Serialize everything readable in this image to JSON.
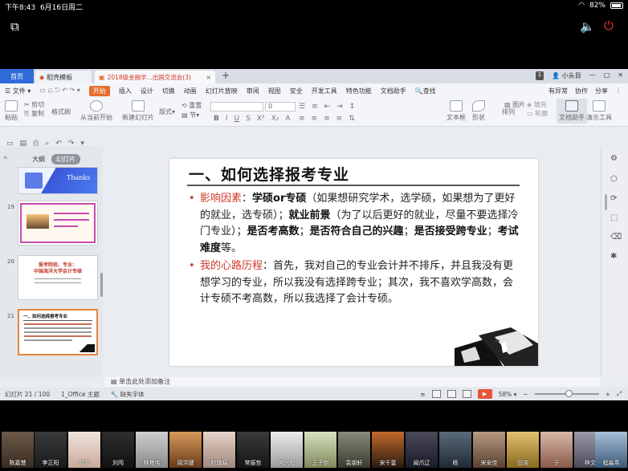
{
  "status_bar": {
    "time": "下午8:43",
    "date": "6月16日周二",
    "wifi": "wifi-icon",
    "battery": "82%"
  },
  "tabs": [
    {
      "label": "首页",
      "active": true
    },
    {
      "label": "稻壳模板"
    },
    {
      "label": "2018级金融学...出国交流会(3)"
    }
  ],
  "tabbar_right": {
    "badge": "1",
    "user": "小头目"
  },
  "menu": {
    "file": "文件",
    "items": [
      "开始",
      "插入",
      "设计",
      "切换",
      "动画",
      "幻灯片放映",
      "审阅",
      "视图",
      "安全",
      "开发工具",
      "特色功能",
      "文档助手"
    ],
    "search": "查找",
    "right": [
      "有异常",
      "协作",
      "分享"
    ]
  },
  "ribbon": {
    "paste": "粘贴",
    "cut": "剪切",
    "copy": "复制",
    "format_painter": "格式刷",
    "from_current": "从当前开始",
    "new_slide": "新建幻灯片",
    "layout": "版式",
    "section": "节",
    "reset": "重置",
    "font_size": "0",
    "textbox": "文本框",
    "shape": "形状",
    "arrange": "排列",
    "picture": "图片",
    "fill": "填充",
    "outline": "轮廓",
    "doc_helper": "文档助手",
    "presenter": "演示工具"
  },
  "left_panel": {
    "tabs": [
      "大纲",
      "幻灯片"
    ],
    "thumb_thanks": "Thanks",
    "slide_numbers": [
      "19",
      "20",
      "21"
    ],
    "thumb20_title": "报考院校、专业：\n中国海洋大学会计专硕",
    "thumb21_title": "一、如何选择报考专业"
  },
  "slide": {
    "title": "一、如何选择报考专业",
    "p1_label": "影响因素",
    "p1_colon": "：",
    "p1_b1": "学硕or专硕",
    "p1_t1": "（如果想研究学术，选学硕，如果想为了更好的就业，选专硕）；",
    "p1_b2": "就业前景",
    "p1_t2": "（为了以后更好的就业，尽量不要选择冷门专业）；",
    "p1_b3": "是否考高数",
    "p1_t3": "；",
    "p1_b4": "是否符合自己的兴趣",
    "p1_t4": "；",
    "p1_b5": "是否接受跨专业",
    "p1_t5": "；",
    "p1_b6": "考试难度",
    "p1_t6": "等。",
    "p2_label": "我的心路历程",
    "p2_text": "：首先，我对自己的专业会计并不排斥，并且我没有更想学习的专业，所以我没有选择跨专业；其次，我不喜欢学高数，会计专硕不考高数，所以我选择了会计专硕。"
  },
  "notes_placeholder": "单击此处添加备注",
  "status": {
    "slide_info": "幻灯片 21 / 100",
    "theme": "1_Office 主题",
    "missing_font": "缺失字体",
    "zoom": "58%"
  },
  "participants": [
    "陈嘉慧",
    "李正阳",
    "赵蕊",
    "刘闯",
    "林骨伟",
    "周洪键",
    "赵旗娟",
    "常振哲",
    "何兴松",
    "王子怡",
    "袁朋轩",
    "宋千壹",
    "闻爪辽",
    "杨",
    "宋安佳",
    "田浩",
    "于",
    "梓文",
    "程淼燕"
  ]
}
